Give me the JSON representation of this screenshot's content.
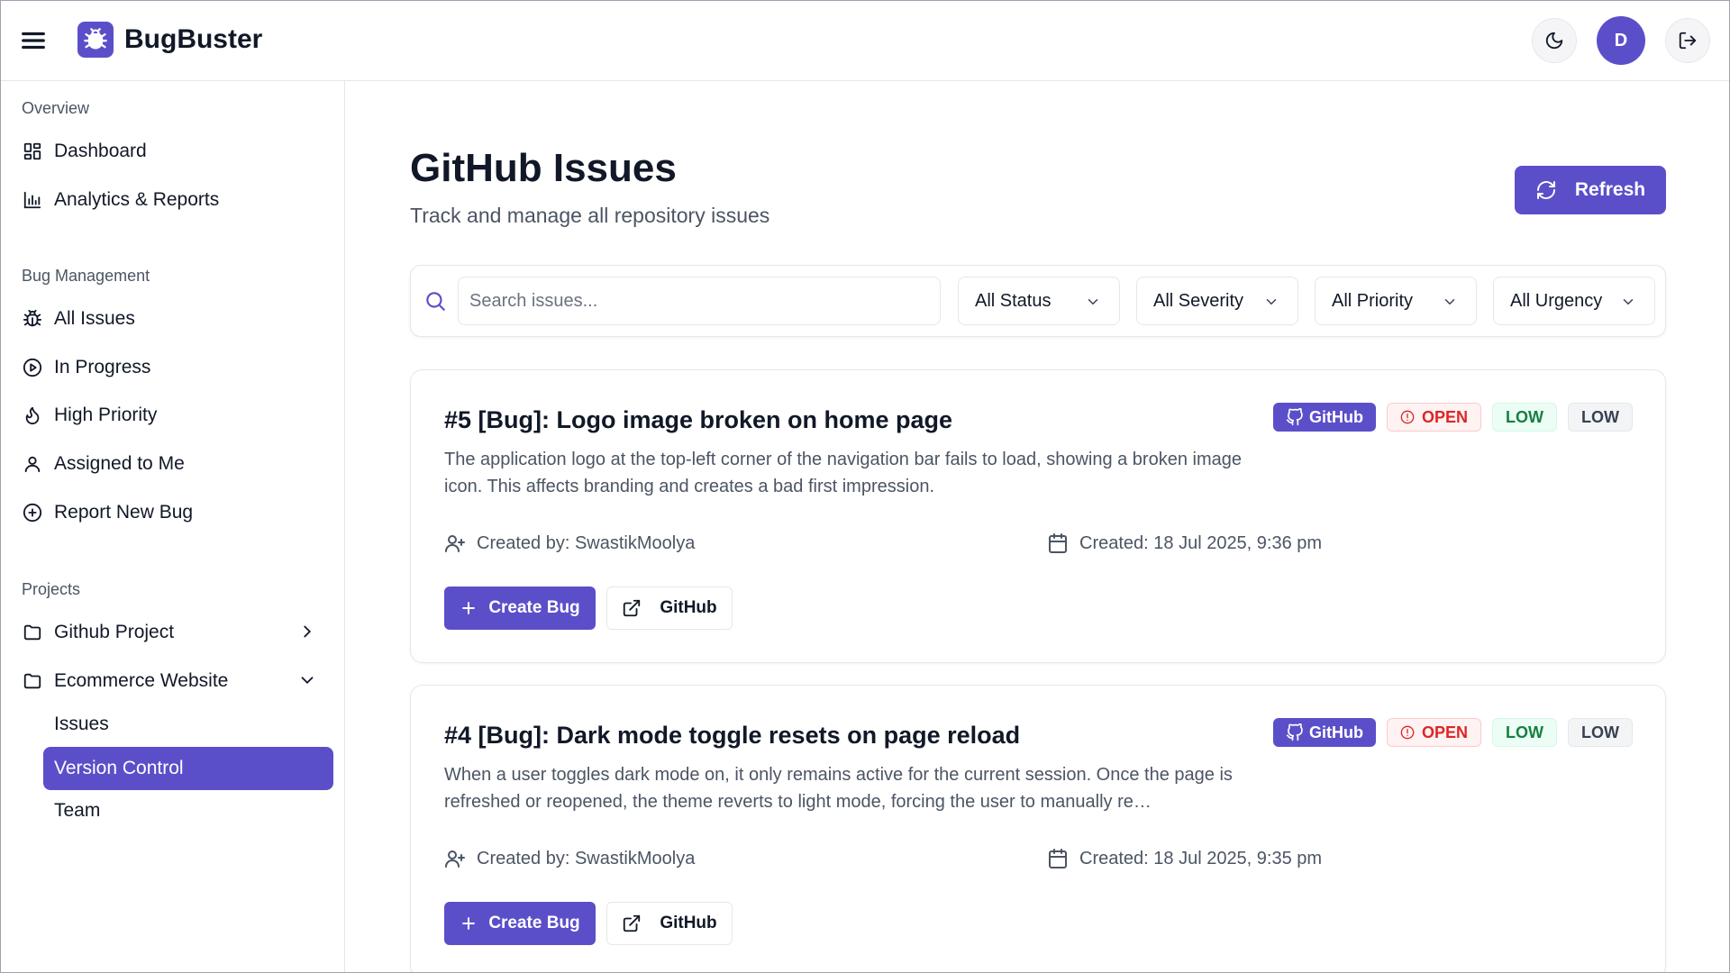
{
  "header": {
    "app_name": "BugBuster",
    "avatar_initial": "D",
    "icons": [
      "menu-icon",
      "bug-icon",
      "moon-icon",
      "logout-icon"
    ]
  },
  "sidebar": {
    "sections": [
      {
        "title": "Overview",
        "items": [
          {
            "label": "Dashboard",
            "icon": "dashboard-icon"
          },
          {
            "label": "Analytics & Reports",
            "icon": "bar-chart-icon"
          }
        ]
      },
      {
        "title": "Bug Management",
        "items": [
          {
            "label": "All Issues",
            "icon": "bug-icon"
          },
          {
            "label": "In Progress",
            "icon": "play-circle-icon"
          },
          {
            "label": "High Priority",
            "icon": "flame-icon"
          },
          {
            "label": "Assigned to Me",
            "icon": "user-icon"
          },
          {
            "label": "Report New Bug",
            "icon": "plus-circle-icon"
          }
        ]
      },
      {
        "title": "Projects",
        "items": [
          {
            "label": "Github Project",
            "icon": "folder-icon",
            "expanded": false
          },
          {
            "label": "Ecommerce Website",
            "icon": "folder-icon",
            "expanded": true
          }
        ],
        "subitems": [
          {
            "label": "Issues",
            "active": false
          },
          {
            "label": "Version Control",
            "active": true
          },
          {
            "label": "Team",
            "active": false
          }
        ]
      }
    ]
  },
  "main": {
    "title": "GitHub Issues",
    "subtitle": "Track and manage all repository issues",
    "refresh_label": "Refresh",
    "search_placeholder": "Search issues...",
    "filters": [
      "All Status",
      "All Severity",
      "All Priority",
      "All Urgency"
    ],
    "issues": [
      {
        "title": "#5 [Bug]: Logo image broken on home page",
        "description": "The application logo at the top-left corner of the navigation bar fails to load, showing a broken image icon. This affects branding and creates a bad first impression.",
        "badges": {
          "source": "GitHub",
          "status": "OPEN",
          "severity": "LOW",
          "priority": "LOW"
        },
        "created_by": "Created by: SwastikMoolya",
        "created_at": "Created: 18 Jul 2025, 9:36 pm",
        "create_bug_label": "Create Bug",
        "github_label": "GitHub"
      },
      {
        "title": "#4 [Bug]: Dark mode toggle resets on page reload",
        "description": "When a user toggles dark mode on, it only remains active for the current session. Once the page is refreshed or reopened, the theme reverts to light mode, forcing the user to manually re…",
        "badges": {
          "source": "GitHub",
          "status": "OPEN",
          "severity": "LOW",
          "priority": "LOW"
        },
        "created_by": "Created by: SwastikMoolya",
        "created_at": "Created: 18 Jul 2025, 9:35 pm",
        "create_bug_label": "Create Bug",
        "github_label": "GitHub"
      }
    ]
  },
  "colors": {
    "accent": "#5b4fc9",
    "open_red": "#dc2626",
    "low_green": "#15803d",
    "border": "#e5e7eb"
  }
}
